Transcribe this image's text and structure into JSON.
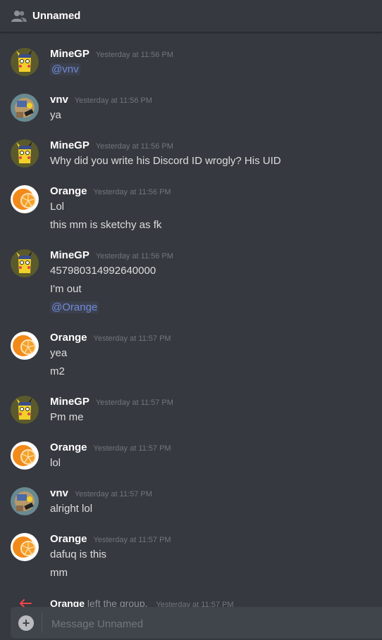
{
  "header": {
    "title": "Unnamed"
  },
  "avatars": {
    "minegp": "pikachu-detective-avatar",
    "vnv": "pokemon-avatar",
    "orange": "orange-fruit-avatar"
  },
  "messages": [
    {
      "author": "MineGP",
      "timestamp": "Yesterday at 11:56 PM",
      "lines": [
        "@vnv"
      ]
    },
    {
      "author": "vnv",
      "timestamp": "Yesterday at 11:56 PM",
      "lines": [
        "ya"
      ]
    },
    {
      "author": "MineGP",
      "timestamp": "Yesterday at 11:56 PM",
      "lines": [
        "Why did you write his Discord ID wrogly? His UID"
      ]
    },
    {
      "author": "Orange",
      "timestamp": "Yesterday at 11:56 PM",
      "lines": [
        "Lol",
        "this mm is sketchy as fk"
      ]
    },
    {
      "author": "MineGP",
      "timestamp": "Yesterday at 11:56 PM",
      "lines": [
        "457980314992640000",
        "I'm out",
        "@Orange"
      ]
    },
    {
      "author": "Orange",
      "timestamp": "Yesterday at 11:57 PM",
      "lines": [
        "yea",
        "m2"
      ]
    },
    {
      "author": "MineGP",
      "timestamp": "Yesterday at 11:57 PM",
      "lines": [
        "Pm me"
      ]
    },
    {
      "author": "Orange",
      "timestamp": "Yesterday at 11:57 PM",
      "lines": [
        "lol"
      ]
    },
    {
      "author": "vnv",
      "timestamp": "Yesterday at 11:57 PM",
      "lines": [
        "alright lol"
      ]
    },
    {
      "author": "Orange",
      "timestamp": "Yesterday at 11:57 PM",
      "lines": [
        "dafuq is this",
        "mm"
      ]
    }
  ],
  "system": {
    "who": "Orange",
    "text": "left the group.",
    "timestamp": "Yesterday at 11:57 PM"
  },
  "composer": {
    "placeholder": "Message Unnamed",
    "plus": "+"
  }
}
